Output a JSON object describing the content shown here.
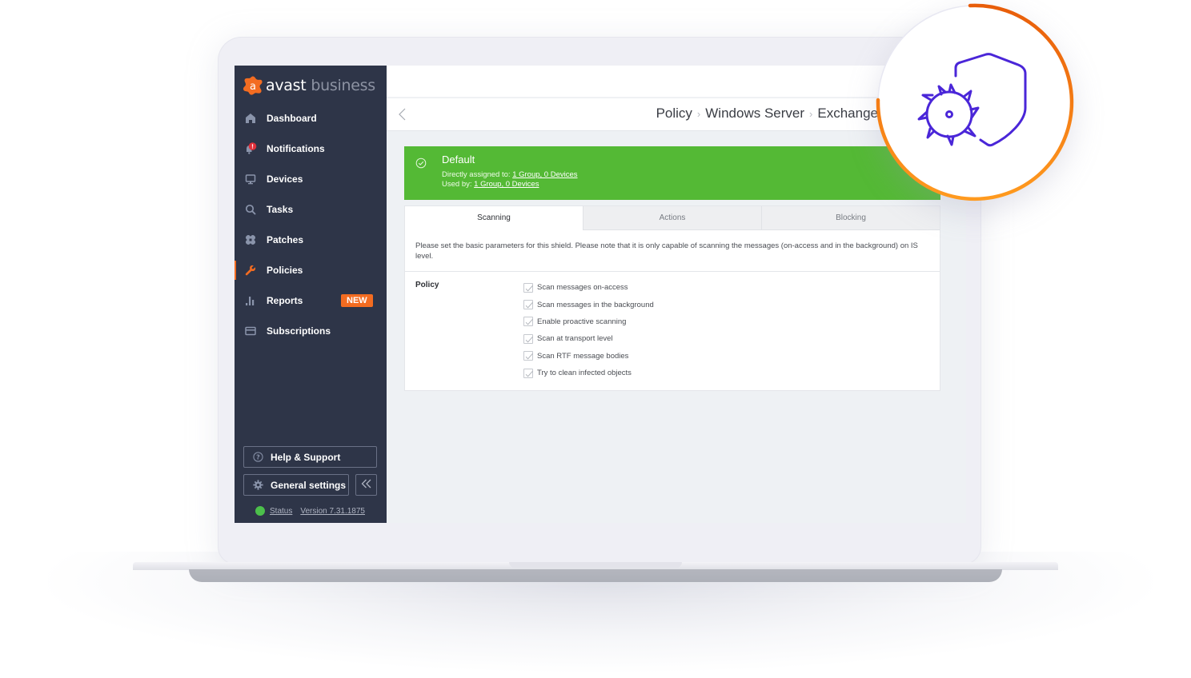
{
  "brand": {
    "name_primary": "avast",
    "name_secondary": "business",
    "accent_color": "#f36c21"
  },
  "sidebar": {
    "items": [
      {
        "id": "dashboard",
        "label": "Dashboard",
        "icon": "home-icon",
        "active": false
      },
      {
        "id": "notifications",
        "label": "Notifications",
        "icon": "bell-icon",
        "active": false,
        "alert": "!"
      },
      {
        "id": "devices",
        "label": "Devices",
        "icon": "monitor-icon",
        "active": false
      },
      {
        "id": "tasks",
        "label": "Tasks",
        "icon": "search-icon",
        "active": false
      },
      {
        "id": "patches",
        "label": "Patches",
        "icon": "bandage-icon",
        "active": false
      },
      {
        "id": "policies",
        "label": "Policies",
        "icon": "wrench-icon",
        "active": true
      },
      {
        "id": "reports",
        "label": "Reports",
        "icon": "bar-chart-icon",
        "active": false,
        "badge": "NEW"
      },
      {
        "id": "subscriptions",
        "label": "Subscriptions",
        "icon": "card-icon",
        "active": false
      }
    ],
    "help_label": "Help & Support",
    "settings_label": "General settings",
    "collapse_icon": "double-chevron-left-icon",
    "status_label": "Status",
    "status_color": "#4cc04b",
    "version_label": "Version 7.31.1875"
  },
  "header": {
    "back_icon": "chevron-left-icon",
    "breadcrumb": [
      "Policy",
      "Windows Server",
      "Exchange"
    ]
  },
  "policy": {
    "name": "Default",
    "status_icon": "check-circle-icon",
    "banner_color": "#54b935",
    "assigned_prefix": "Directly assigned to:",
    "assigned_link": "1 Group, 0 Devices",
    "used_prefix": "Used by:",
    "used_link": "1 Group, 0 Devices"
  },
  "tabs": [
    {
      "label": "Scanning",
      "active": true
    },
    {
      "label": "Actions",
      "active": false
    },
    {
      "label": "Blocking",
      "active": false
    }
  ],
  "scanning": {
    "description": "Please set the basic parameters for this shield. Please note that it is only capable of scanning the messages (on-access and in the background) on IS level.",
    "section_label": "Policy",
    "options": [
      {
        "label": "Scan messages on-access",
        "checked": true
      },
      {
        "label": "Scan messages in the background",
        "checked": true
      },
      {
        "label": "Enable proactive scanning",
        "checked": true
      },
      {
        "label": "Scan at transport level",
        "checked": true
      },
      {
        "label": "Scan RTF message bodies",
        "checked": true
      },
      {
        "label": "Try to clean infected objects",
        "checked": true
      }
    ]
  },
  "feature_badge": {
    "icon": "virus-shield-icon",
    "icon_color": "#4a26d8",
    "ring_colors": [
      "#e85d0a",
      "#ff9a1f"
    ]
  }
}
